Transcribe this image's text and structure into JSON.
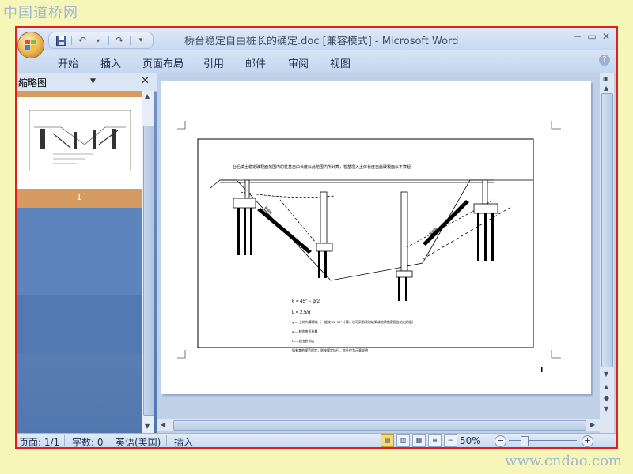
{
  "watermark": {
    "top_text": "中国道桥网",
    "bottom_text": "www.cndao.com"
  },
  "window": {
    "title": "桥台稳定自由桩长的确定.doc [兼容模式] - Microsoft Word",
    "minimize_icon": "minimize-icon",
    "maximize_icon": "maximize-icon",
    "close_icon": "close-icon"
  },
  "quick_access": {
    "save_icon": "save-icon",
    "undo_icon": "undo-icon",
    "redo_icon": "redo-icon",
    "customize_icon": "dropdown-icon"
  },
  "ribbon": {
    "tabs": [
      "开始",
      "插入",
      "页面布局",
      "引用",
      "邮件",
      "审阅",
      "视图"
    ],
    "help_icon": "help-icon"
  },
  "side_pane": {
    "title": "缩略图",
    "thumbnail_page_number": "1"
  },
  "status": {
    "page": "页面: 1/1",
    "words": "字数: 0",
    "language": "英语(美国)",
    "mode": "插入",
    "zoom": "50%",
    "zoom_minus": "−",
    "zoom_plus": "+"
  },
  "document": {
    "drawing": {
      "header_note": "台后填土稳定破裂面范围内的桩基自由长度以此范围内所计算，桩基埋入土体长度自此破裂面以下算起",
      "formula_angle": "θ = 45° − φ/2",
      "formula_length": "L = 2.5/α",
      "legend_phi": "φ — 土的内摩擦角（一般按 30~35° 计算，也可采用试验结果或地质勘察报告给出的值）",
      "legend_alpha": "α — 桩的变形系数",
      "legend_l": "L — 自由桩长度",
      "legend_note": "如有其他规范规定，则按规定执行，此处仅为示意说明",
      "label_break_left": "破裂面",
      "label_break_right": "破裂面"
    }
  },
  "colors": {
    "frame_border": "#e02020",
    "watermark": "#9fb6d8",
    "page_bg": "#f6f6b8"
  }
}
